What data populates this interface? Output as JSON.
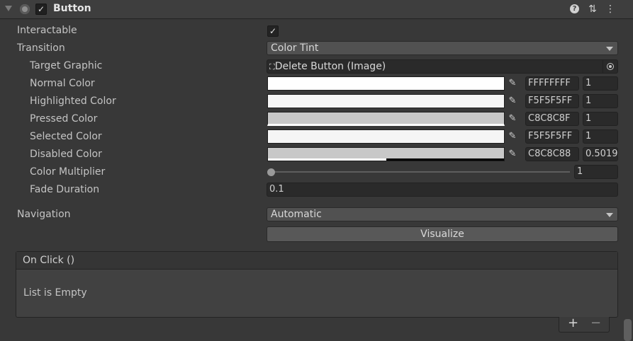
{
  "header": {
    "title": "Button",
    "enabled": true,
    "icons": [
      "foldout-arrow-icon",
      "component-icon",
      "help-icon",
      "preset-icon",
      "kebab-menu-icon"
    ]
  },
  "fields": {
    "interactable": {
      "label": "Interactable",
      "checked": true
    },
    "transition": {
      "label": "Transition",
      "value": "Color Tint"
    },
    "target_graphic": {
      "label": "Target Graphic",
      "value": "Delete Button (Image)"
    },
    "normal_color": {
      "label": "Normal Color",
      "hex": "FFFFFFFF",
      "multiplier": "1",
      "color": "#ffffff"
    },
    "highlighted_color": {
      "label": "Highlighted Color",
      "hex": "F5F5F5FF",
      "multiplier": "1",
      "color": "#f5f5f5"
    },
    "pressed_color": {
      "label": "Pressed Color",
      "hex": "C8C8C8F",
      "multiplier": "1",
      "color": "#c8c8c8"
    },
    "selected_color": {
      "label": "Selected Color",
      "hex": "F5F5F5FF",
      "multiplier": "1",
      "color": "#f5f5f5"
    },
    "disabled_color": {
      "label": "Disabled Color",
      "hex": "C8C8C88",
      "multiplier": "0.5019",
      "color": "#c8c8c8",
      "alpha_fraction": 0.5
    },
    "color_multiplier": {
      "label": "Color Multiplier",
      "value": "1",
      "slider_fraction": 0.0
    },
    "fade_duration": {
      "label": "Fade Duration",
      "value": "0.1"
    },
    "navigation": {
      "label": "Navigation",
      "value": "Automatic"
    },
    "visualize": {
      "label": "Visualize"
    }
  },
  "on_click": {
    "title": "On Click ()",
    "empty_text": "List is Empty",
    "add_label": "+",
    "remove_label": "−"
  },
  "icons": {
    "picker": "eyedropper-icon",
    "image": "image-icon",
    "object_picker": "object-picker-icon"
  }
}
